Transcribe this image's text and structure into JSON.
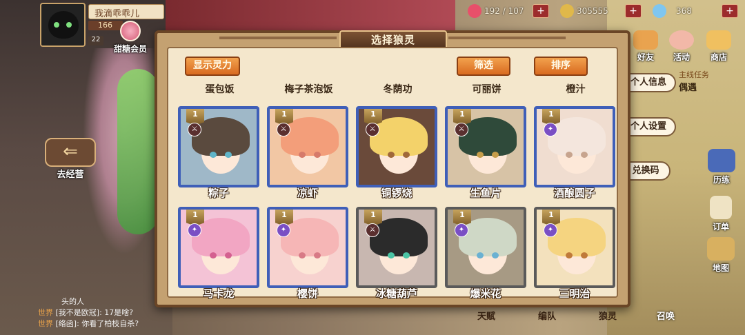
{
  "player": {
    "name": "我滴乖乖儿",
    "exp": "166",
    "level": "22"
  },
  "vip": {
    "label": "甜糖会员"
  },
  "resources": [
    {
      "icon": "heart-icon",
      "value": "192 / 107",
      "color": "#e8506a"
    },
    {
      "icon": "coin-icon",
      "value": "305555",
      "color": "#e0b84a"
    },
    {
      "icon": "diamond-icon",
      "value": "368",
      "color": "#7fc6f0"
    }
  ],
  "right_menu": {
    "top_buttons": [
      "好友",
      "活动",
      "商店"
    ],
    "personal_info": "个人信息",
    "personal_settings": "个人设置",
    "redeem_code": "兑换码",
    "quest_label": "主线任务",
    "quest_name": "偶遇",
    "side_items": [
      "历练",
      "订单",
      "地图"
    ]
  },
  "left_menu": {
    "goto_business": "去经营"
  },
  "chat": {
    "header": "头的人",
    "messages": [
      {
        "channel": "世界",
        "text": "[我不是欧冠]: 17是啥?"
      },
      {
        "channel": "世界",
        "text": "[络函]: 你看了柏枝自杀?"
      }
    ]
  },
  "bottom_nav": [
    "天赋",
    "编队",
    "狼灵",
    "召唤"
  ],
  "dialog": {
    "title": "选择狼灵",
    "show_power": "显示灵力",
    "filter": "筛选",
    "sort": "排序",
    "prev_row_names": [
      "蛋包饭",
      "梅子茶泡饭",
      "冬荫功",
      "可丽饼",
      "橙汁"
    ],
    "cards": [
      {
        "name": "粽子",
        "level": "1",
        "elem": "dark",
        "frame": "blue",
        "hair": "#5a4a3e",
        "eye": "#5fb5c9",
        "bg": "#9fb8c8"
      },
      {
        "name": "凉虾",
        "level": "1",
        "elem": "dark",
        "frame": "blue",
        "hair": "#f39e7a",
        "eye": "#d67a6a",
        "bg": "#f2c7a4"
      },
      {
        "name": "铜锣烧",
        "level": "1",
        "elem": "dark",
        "frame": "blue",
        "hair": "#f3d26a",
        "eye": "#a0683a",
        "bg": "#6a4a3a"
      },
      {
        "name": "生鱼片",
        "level": "1",
        "elem": "dark",
        "frame": "blue",
        "hair": "#2f4a3a",
        "eye": "#c69d4a",
        "bg": "#d7c3a6"
      },
      {
        "name": "酒酿圆子",
        "level": "1",
        "elem": "purple",
        "frame": "blue",
        "hair": "#f4e6dd",
        "eye": "#c7a48e",
        "bg": "#f0ddd0"
      },
      {
        "name": "马卡龙",
        "level": "1",
        "elem": "purple",
        "frame": "blue",
        "hair": "#f2a6c3",
        "eye": "#d46090",
        "bg": "#f4c3d6"
      },
      {
        "name": "樱饼",
        "level": "1",
        "elem": "purple",
        "frame": "blue",
        "hair": "#f6b6b6",
        "eye": "#d87a86",
        "bg": "#f7d2cf"
      },
      {
        "name": "冰糖葫芦",
        "level": "1",
        "elem": "dark",
        "frame": "grey",
        "hair": "#2b2b2b",
        "eye": "#4ac4a4",
        "bg": "#c8b7b0"
      },
      {
        "name": "爆米花",
        "level": "1",
        "elem": "purple",
        "frame": "grey",
        "hair": "#cfd8c6",
        "eye": "#6ab1d2",
        "bg": "#a79a84"
      },
      {
        "name": "三明治",
        "level": "1",
        "elem": "purple",
        "frame": "grey",
        "hair": "#f5d480",
        "eye": "#c07a3a",
        "bg": "#f3e1bd"
      }
    ]
  }
}
